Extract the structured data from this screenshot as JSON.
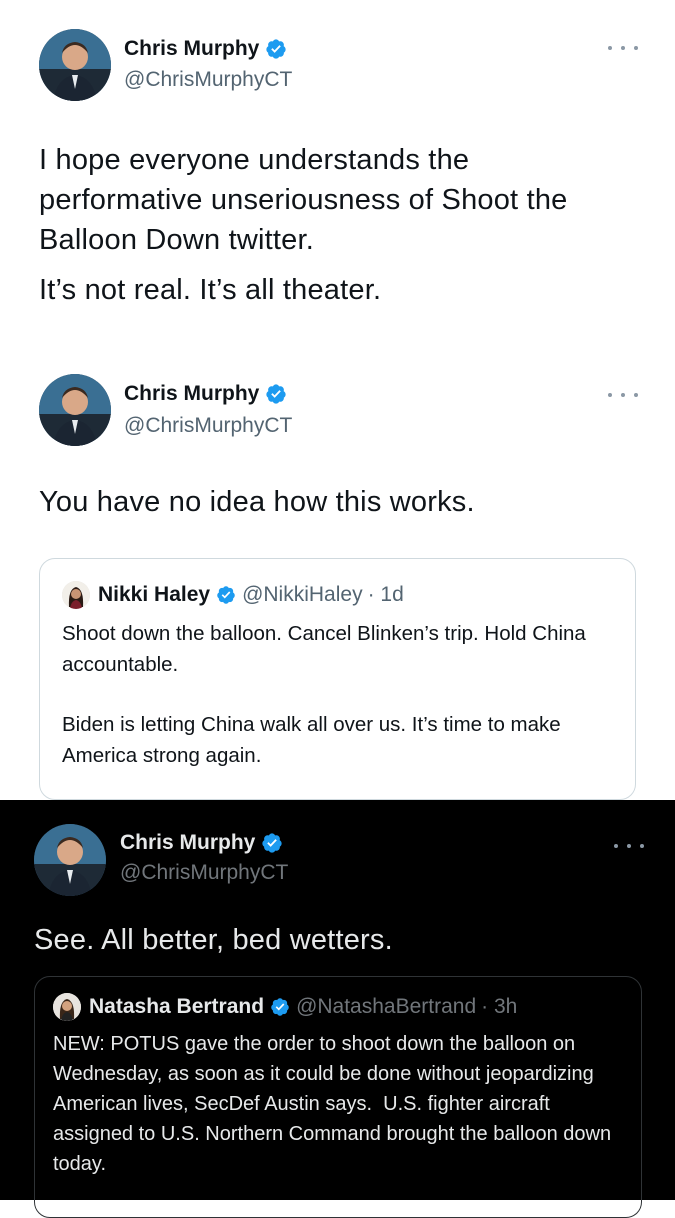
{
  "tweet1": {
    "author_name": "Chris Murphy",
    "author_handle": "@ChrisMurphyCT",
    "text_lines": [
      "I hope everyone understands the performative unseriousness of Shoot the Balloon Down twitter.",
      "It’s not real. It’s all theater."
    ],
    "verified_icon": "verified-badge-icon",
    "more_icon": "more-options-icon"
  },
  "tweet2": {
    "author_name": "Chris Murphy",
    "author_handle": "@ChrisMurphyCT",
    "text": "You have no idea how this works.",
    "quoted": {
      "author_name": "Nikki Haley",
      "author_handle": "@NikkiHaley",
      "time": "· 1d",
      "para1": "Shoot down the balloon. Cancel Blinken’s trip. Hold China accountable.",
      "para2": "Biden is letting China walk all over us. It’s time to make America strong again."
    }
  },
  "tweet3": {
    "theme": "dark",
    "author_name": "Chris Murphy",
    "author_handle": "@ChrisMurphyCT",
    "text": "See. All better, bed wetters.",
    "quoted": {
      "author_name": "Natasha Bertrand",
      "author_handle": "@NatashaBertrand",
      "time": "· 3h",
      "text": "NEW: POTUS gave the order to shoot down the balloon on Wednesday, as soon as it could be done without jeopardizing American lives, SecDef Austin says.  U.S. fighter aircraft assigned to U.S. Northern Command brought the balloon down today."
    }
  },
  "colors": {
    "verified_blue": "#1d9bf0",
    "secondary_text_light": "#536471",
    "secondary_text_dark": "#71767b",
    "dark_bg": "#000000"
  }
}
